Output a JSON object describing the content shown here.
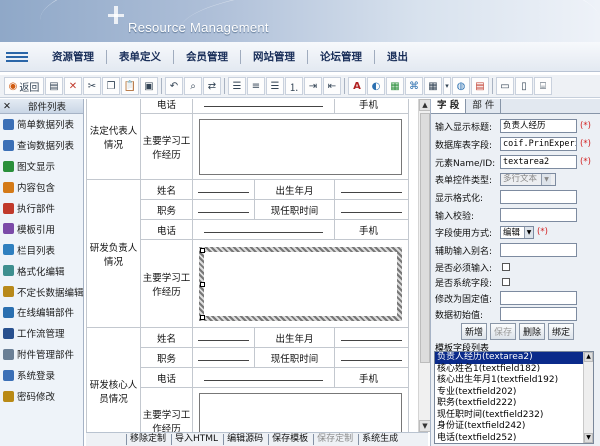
{
  "banner": {
    "title": "Resource Management"
  },
  "menu": {
    "items": [
      "资源管理",
      "表单定义",
      "会员管理",
      "网站管理",
      "论坛管理",
      "退出"
    ]
  },
  "toolbar": {
    "back_label": "返回"
  },
  "sidebar": {
    "header": "部件列表",
    "items": [
      {
        "label": "简单数据列表",
        "icon": "grid-icon",
        "color": "#3b6fb6"
      },
      {
        "label": "查询数据列表",
        "icon": "grid-search-icon",
        "color": "#3b6fb6"
      },
      {
        "label": "图文显示",
        "icon": "image-text-icon",
        "color": "#2a8f3a"
      },
      {
        "label": "内容包含",
        "icon": "include-icon",
        "color": "#d47a18"
      },
      {
        "label": "执行部件",
        "icon": "execute-icon",
        "color": "#c0392b"
      },
      {
        "label": "模板引用",
        "icon": "template-ref-icon",
        "color": "#7b4aa8"
      },
      {
        "label": "栏目列表",
        "icon": "column-list-icon",
        "color": "#2f7fbf"
      },
      {
        "label": "格式化编辑",
        "icon": "format-edit-icon",
        "color": "#3e8f8f"
      },
      {
        "label": "不定长数据编辑",
        "icon": "variable-edit-icon",
        "color": "#b8891a"
      },
      {
        "label": "在线编辑部件",
        "icon": "online-edit-icon",
        "color": "#2a6fb0"
      },
      {
        "label": "工作流管理",
        "icon": "workflow-icon",
        "color": "#28508f"
      },
      {
        "label": "附件管理部件",
        "icon": "attachment-icon",
        "color": "#6a7f96"
      },
      {
        "label": "系统登录",
        "icon": "login-icon",
        "color": "#3b6fb6"
      },
      {
        "label": "密码修改",
        "icon": "key-icon",
        "color": "#b98a16"
      }
    ]
  },
  "form": {
    "labels": {
      "phone": "电话",
      "mobile": "手机",
      "resume": "主要学习工作经历",
      "name": "姓名",
      "birth": "出生年月",
      "post": "职务",
      "hire_time": "现任职时间"
    },
    "sections": [
      "法定代表人情况",
      "研发负责人情况",
      "研发核心人员情况"
    ]
  },
  "bottombar": {
    "buttons": [
      {
        "label": "移除定制",
        "enabled": true
      },
      {
        "label": "导入HTML",
        "enabled": true
      },
      {
        "label": "编辑源码",
        "enabled": true
      },
      {
        "label": "保存模板",
        "enabled": true
      },
      {
        "label": "保存定制",
        "enabled": false
      },
      {
        "label": "系统生成",
        "enabled": true
      }
    ]
  },
  "panel": {
    "tabs": [
      "字 段",
      "部 件"
    ],
    "fields": {
      "display_title_label": "输入显示标题:",
      "display_title": "负责人经历",
      "db_field_label": "数据库表字段:",
      "db_field": "coif.PrinExperie",
      "element_label": "元素Name/ID:",
      "element": "textarea2",
      "control_type_label": "表单控件类型:",
      "control_type": "多行文本",
      "display_format_label": "显示格式化:",
      "display_format": "",
      "input_check_label": "输入校验:",
      "input_check": "",
      "usage_label": "字段使用方式:",
      "usage": "编辑",
      "alias_label": "辅助输入别名:",
      "alias": "",
      "required_label": "是否必须输入:",
      "system_label": "是否系统字段:",
      "fixed_label": "修改为固定值:",
      "fixed": "",
      "initial_label": "数据初始值:",
      "initial": "",
      "required_mark": "(*)"
    },
    "buttons": [
      {
        "label": "新增",
        "enabled": true
      },
      {
        "label": "保存",
        "enabled": false
      },
      {
        "label": "删除",
        "enabled": true
      },
      {
        "label": "绑定",
        "enabled": true
      }
    ],
    "list_label": "模板字段列表",
    "list_items": [
      "负责人经历(textarea2)",
      "核心姓名1(textfield182)",
      "核心出生年月1(textfield192)",
      "专业(textfield202)",
      "职务(textfield222)",
      "现任职时间(textfield232)",
      "身份证(textfield242)",
      "电话(textfield252)"
    ],
    "list_selected": 0
  }
}
